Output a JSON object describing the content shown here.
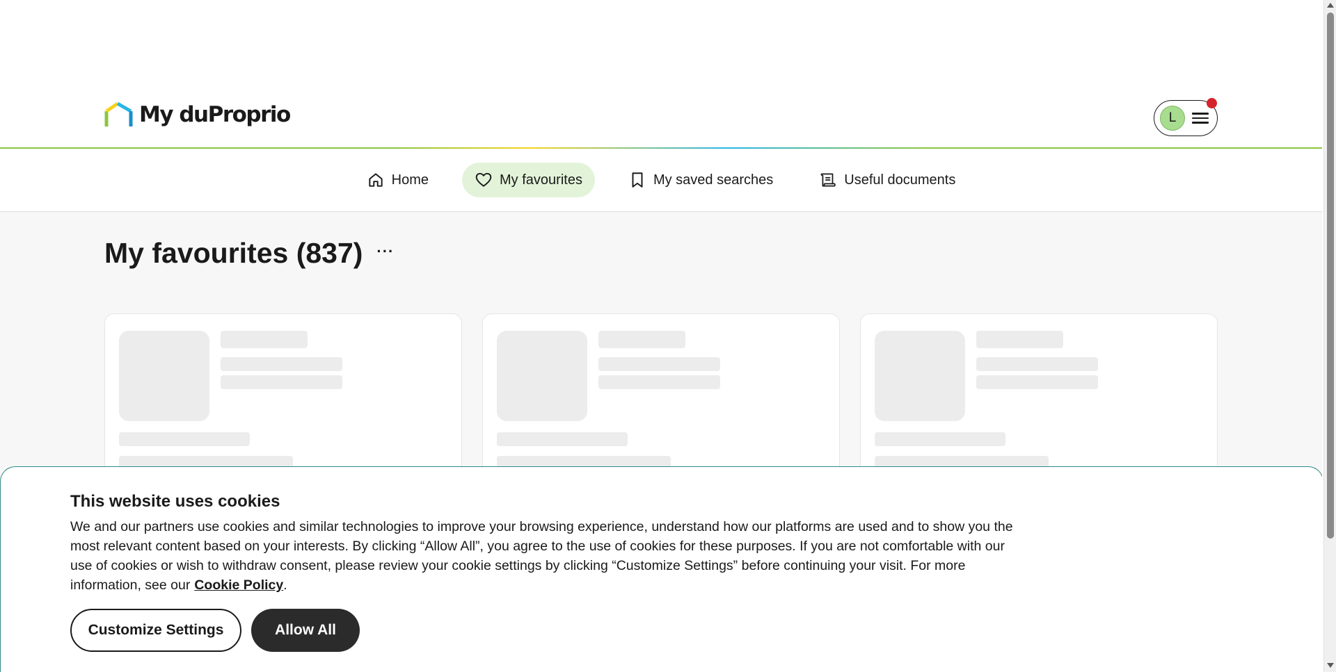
{
  "header": {
    "logo_text": "My duProprio",
    "avatar_initial": "L"
  },
  "nav": {
    "items": [
      {
        "label": "Home",
        "icon": "home-icon",
        "active": false
      },
      {
        "label": "My favourites",
        "icon": "heart-icon",
        "active": true
      },
      {
        "label": "My saved searches",
        "icon": "bookmark-icon",
        "active": false
      },
      {
        "label": "Useful documents",
        "icon": "document-scroll-icon",
        "active": false
      }
    ]
  },
  "main": {
    "title": "My favourites (837)",
    "more_label": "···"
  },
  "cookie_banner": {
    "title": "This website uses cookies",
    "body": "We and our partners use cookies and similar technologies to improve your browsing experience, understand how our platforms are used and to show you the most relevant content based on your interests. By clicking “Allow All”, you agree to the use of cookies for these purposes. If you are not comfortable with our use of cookies or wish to withdraw consent, please review your cookie settings by clicking “Customize Settings” before continuing your visit. For more information, see our",
    "link_label": "Cookie Policy",
    "link_suffix": ".",
    "customize_label": "Customize Settings",
    "allow_label": "Allow All"
  },
  "colors": {
    "accent_green": "#8cc63f",
    "active_tab_bg": "#e3f3d9",
    "notification": "#d6242b",
    "cookie_border": "#2f8a86"
  }
}
